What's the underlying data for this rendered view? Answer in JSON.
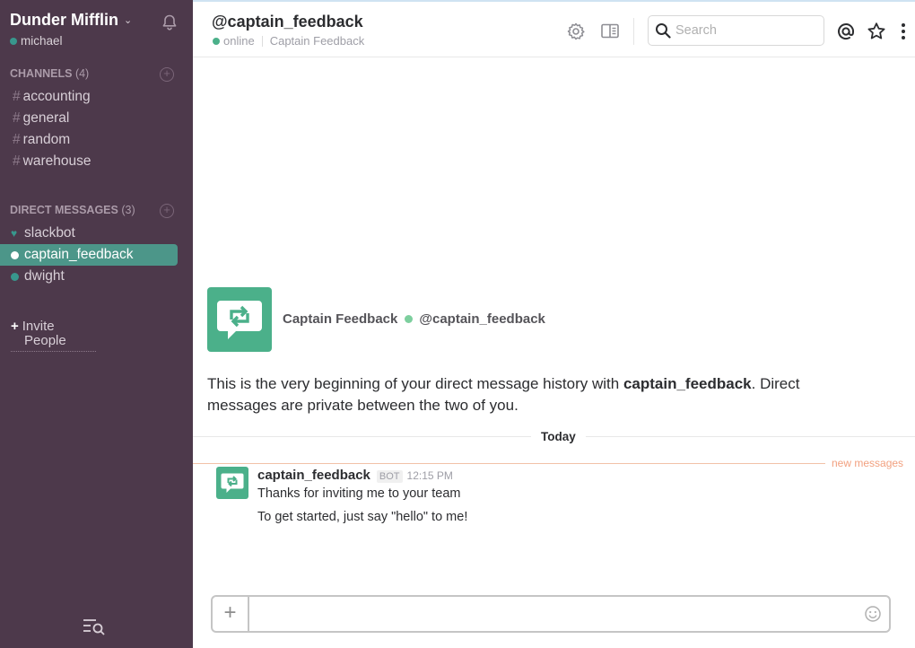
{
  "team": {
    "name": "Dunder Mifflin",
    "user": "michael"
  },
  "channels": {
    "title": "CHANNELS",
    "count": "(4)",
    "items": [
      {
        "label": "accounting"
      },
      {
        "label": "general"
      },
      {
        "label": "random"
      },
      {
        "label": "warehouse"
      }
    ]
  },
  "direct_messages": {
    "title": "DIRECT MESSAGES",
    "count": "(3)",
    "items": [
      {
        "label": "slackbot",
        "status": "heart"
      },
      {
        "label": "captain_feedback",
        "status": "online",
        "active": true
      },
      {
        "label": "dwight",
        "status": "online"
      }
    ]
  },
  "invite": {
    "line1": "Invite",
    "line2": "People"
  },
  "header": {
    "channel_name": "@captain_feedback",
    "status": "online",
    "full_name": "Captain Feedback",
    "search_placeholder": "Search"
  },
  "intro": {
    "display_name": "Captain Feedback",
    "handle": "@captain_feedback",
    "text_before": "This is the very beginning of your direct message history with ",
    "text_bold": "captain_feedback",
    "text_after": ". Direct messages are private between the two of you."
  },
  "divider": {
    "day": "Today",
    "new_messages": "new messages"
  },
  "message": {
    "author": "captain_feedback",
    "badge": "BOT",
    "time": "12:15 PM",
    "lines": [
      "Thanks for inviting me to your team",
      "To get started, just say \"hello\" to me!"
    ]
  },
  "colors": {
    "sidebar_bg": "#4d394b",
    "active_item": "#4c9689",
    "presence": "#4bb08a",
    "new_messages": "#f2a07f"
  },
  "icons": [
    "bell-icon",
    "gear-icon",
    "sidebar-toggle-icon",
    "search-icon",
    "mention-icon",
    "star-icon",
    "more-icon",
    "add-icon",
    "emoji-icon",
    "feedback-bot-icon",
    "quick-switcher-icon"
  ]
}
